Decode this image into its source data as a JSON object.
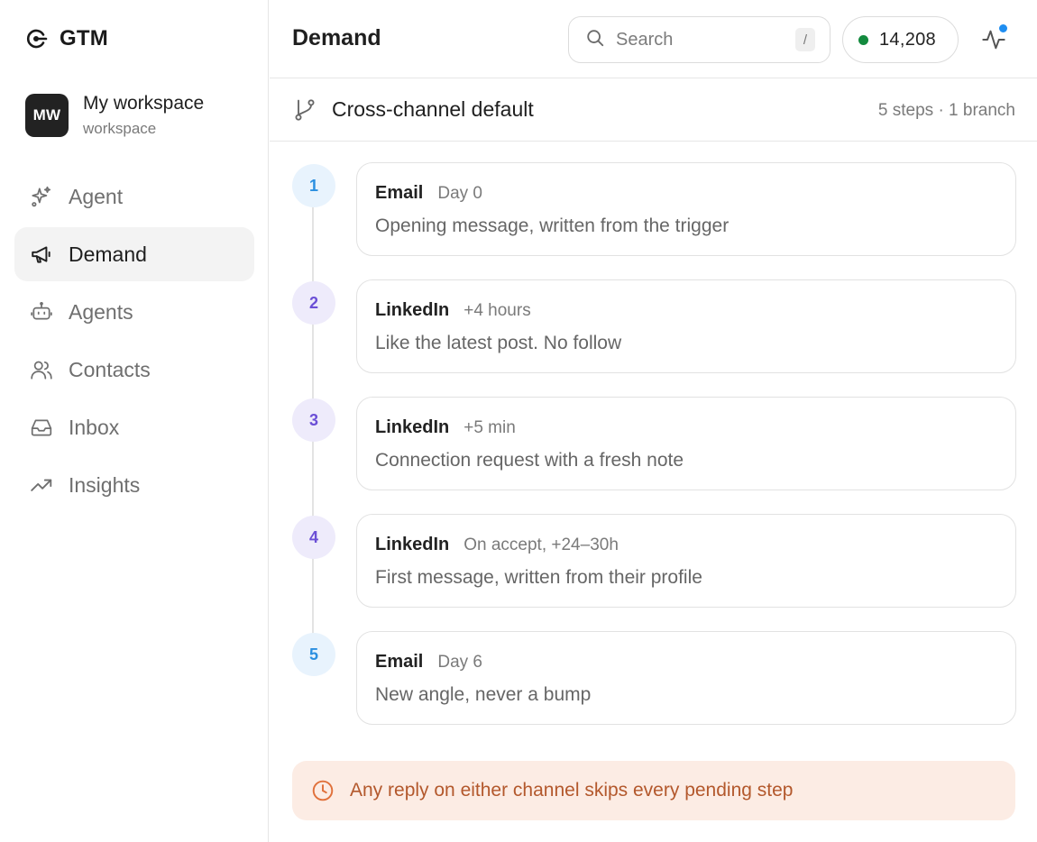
{
  "brand": {
    "name": "GTM",
    "icon": "target-icon"
  },
  "workspace": {
    "initials": "MW",
    "name": "My workspace",
    "subtitle": "workspace"
  },
  "sidebar": {
    "items": [
      {
        "label": "Agent",
        "icon": "sparkles-icon",
        "active": false
      },
      {
        "label": "Demand",
        "icon": "megaphone-icon",
        "active": true
      },
      {
        "label": "Agents",
        "icon": "robot-icon",
        "active": false
      },
      {
        "label": "Contacts",
        "icon": "users-icon",
        "active": false
      },
      {
        "label": "Inbox",
        "icon": "inbox-icon",
        "active": false
      },
      {
        "label": "Insights",
        "icon": "trending-up-icon",
        "active": false
      }
    ]
  },
  "header": {
    "title": "Demand",
    "search": {
      "placeholder": "Search",
      "shortcut": "/"
    },
    "credits": {
      "value": "14,208",
      "status_color": "#138a3e"
    },
    "activity_icon": "activity-icon",
    "notification_color": "#1f8ef1"
  },
  "sequence": {
    "icon": "git-branch-icon",
    "title": "Cross-channel default",
    "meta": "5 steps · 1 branch"
  },
  "steps": [
    {
      "number": "1",
      "channel": "Email",
      "timing": "Day 0",
      "description": "Opening message, written from the trigger"
    },
    {
      "number": "2",
      "channel": "LinkedIn",
      "timing": "+4 hours",
      "description": "Like the latest post. No follow"
    },
    {
      "number": "3",
      "channel": "LinkedIn",
      "timing": "+5 min",
      "description": "Connection request with a fresh note"
    },
    {
      "number": "4",
      "channel": "LinkedIn",
      "timing": "On accept, +24–30h",
      "description": "First message, written from their profile"
    },
    {
      "number": "5",
      "channel": "Email",
      "timing": "Day 6",
      "description": "New angle, never a bump"
    }
  ],
  "notice": {
    "icon": "clock-icon",
    "text": "Any reply on either channel skips every pending step",
    "color": "#b3582c"
  }
}
